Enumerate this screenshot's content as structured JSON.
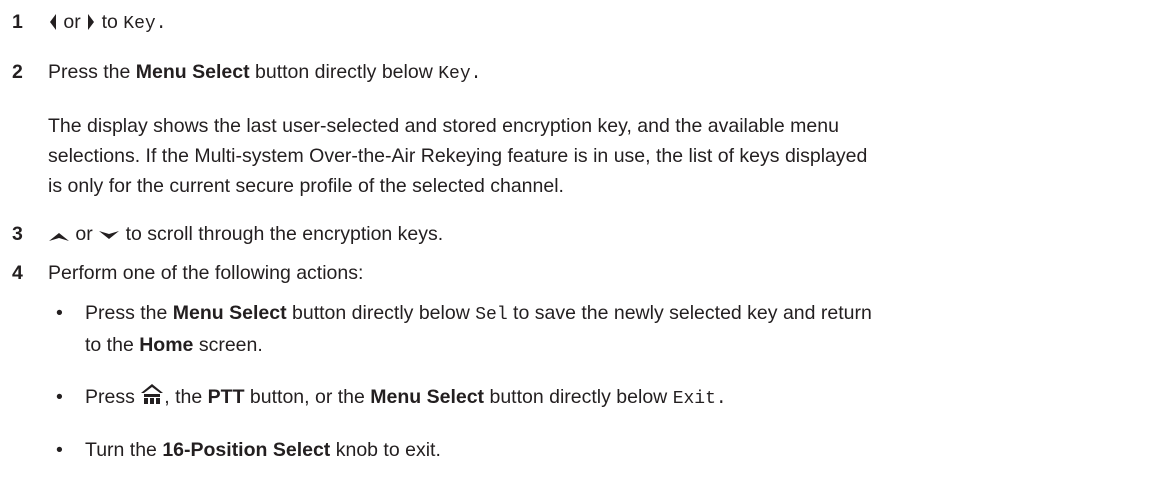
{
  "steps": {
    "s1": {
      "number": "1",
      "or": "or",
      "to": "to",
      "target": "Key."
    },
    "s2": {
      "number": "2",
      "pre": "Press the",
      "button": "Menu Select",
      "mid": "button directly below",
      "target": "Key."
    },
    "para_line1": "The display shows the last user-selected and stored encryption key, and the available menu",
    "para_line2": "selections. If the Multi-system Over-the-Air Rekeying feature is in use, the list of keys displayed",
    "para_line3": "is only for the current secure profile of the selected channel.",
    "s3": {
      "number": "3",
      "or": "or",
      "rest": "to scroll through the encryption keys."
    },
    "s4": {
      "number": "4",
      "text": "Perform one of the following actions:"
    }
  },
  "bullets": {
    "b1": {
      "pre": "Press the",
      "button": "Menu Select",
      "mid": "button directly below",
      "target": "Sel",
      "post": "to save the newly selected key and return",
      "line2_pre": "to the",
      "home": "Home",
      "line2_post": "screen."
    },
    "b2": {
      "pre": "Press",
      "comma": ", the",
      "ptt": "PTT",
      "mid": "button, or the",
      "button": "Menu Select",
      "mid2": "button directly below",
      "target": "Exit."
    },
    "b3": {
      "pre": "Turn the",
      "knob": "16-Position Select",
      "post": "knob to exit."
    },
    "bullet_char": "•"
  },
  "icons": {
    "left": "left-arrow-icon",
    "right": "right-arrow-icon",
    "up": "up-arrow-icon",
    "down": "down-arrow-icon",
    "home": "home-icon"
  }
}
